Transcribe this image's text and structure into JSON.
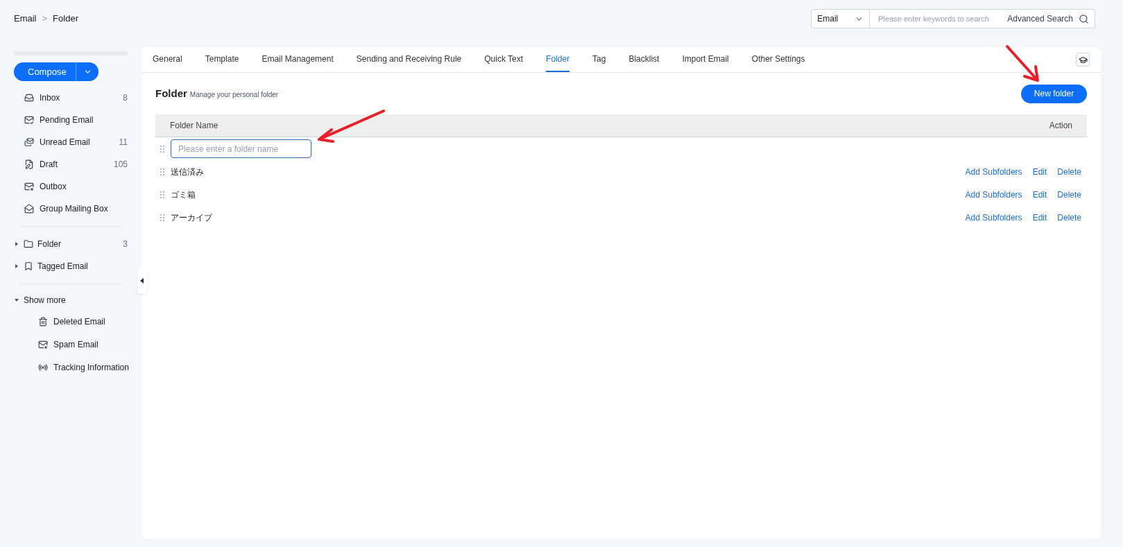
{
  "breadcrumb": [
    "Email",
    "Folder"
  ],
  "breadcrumb_separator": ">",
  "search": {
    "scope": "Email",
    "placeholder": "Please enter keywords to search",
    "advanced": "Advanced Search"
  },
  "sidebar": {
    "compose": "Compose",
    "mailboxes": [
      {
        "label": "Inbox",
        "count": "8"
      },
      {
        "label": "Pending Email"
      },
      {
        "label": "Unread Email",
        "count": "11"
      },
      {
        "label": "Draft",
        "count": "105"
      },
      {
        "label": "Outbox"
      },
      {
        "label": "Group Mailing Box"
      }
    ],
    "groups": [
      {
        "label": "Folder",
        "count": "3",
        "expanded": false
      },
      {
        "label": "Tagged Email",
        "expanded": false
      }
    ],
    "more": {
      "label": "Show more",
      "expanded": true,
      "children": [
        {
          "label": "Deleted Email"
        },
        {
          "label": "Spam Email"
        },
        {
          "label": "Tracking Information"
        }
      ]
    }
  },
  "tabs": [
    {
      "label": "General",
      "selected": false
    },
    {
      "label": "Template",
      "selected": false
    },
    {
      "label": "Email Management",
      "selected": false
    },
    {
      "label": "Sending and Receiving Rule",
      "selected": false
    },
    {
      "label": "Quick Text",
      "selected": false
    },
    {
      "label": "Folder",
      "selected": true
    },
    {
      "label": "Tag",
      "selected": false
    },
    {
      "label": "Blacklist",
      "selected": false
    },
    {
      "label": "Import Email",
      "selected": false
    },
    {
      "label": "Other Settings",
      "selected": false
    }
  ],
  "section": {
    "title": "Folder",
    "subtitle": "Manage your personal folder",
    "new_button": "New folder"
  },
  "table": {
    "columns": [
      "Folder Name",
      "Action"
    ],
    "rows": [
      {
        "kind": "input",
        "placeholder": "Please enter a folder name"
      },
      {
        "kind": "folder",
        "name": "送信済み",
        "actions": [
          "Add Subfolders",
          "Edit",
          "Delete"
        ]
      },
      {
        "kind": "folder",
        "name": "ゴミ箱",
        "actions": [
          "Add Subfolders",
          "Edit",
          "Delete"
        ]
      },
      {
        "kind": "folder",
        "name": "アーカイブ",
        "actions": [
          "Add Subfolders",
          "Edit",
          "Delete"
        ]
      }
    ]
  }
}
